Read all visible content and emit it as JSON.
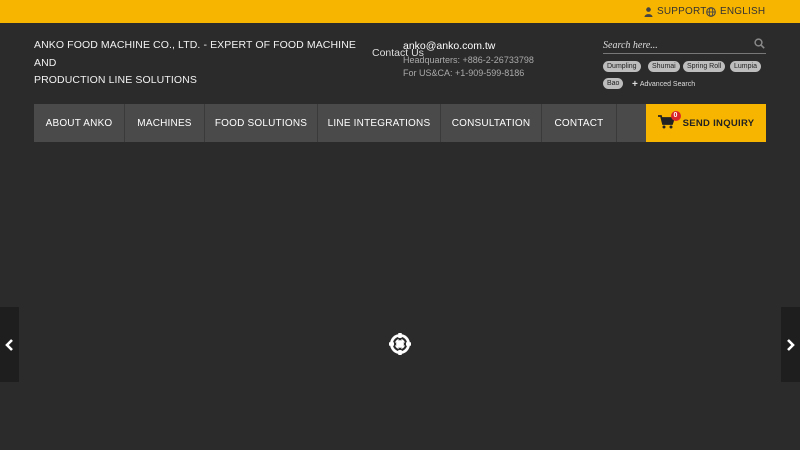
{
  "topbar": {
    "support_label": "SUPPORT",
    "language_label": "ENGLISH",
    "background": "#f8b500"
  },
  "header": {
    "company_line1": "ANKO FOOD MACHINE CO., LTD. - EXPERT OF FOOD MACHINE AND",
    "company_line2": "PRODUCTION LINE SOLUTIONS",
    "contact_link": "Contact Us",
    "email": "anko@anko.com.tw",
    "headquarters": "Headquarters: +886-2-26733798",
    "us_phone": "For US&CA: +1-909-599-8186"
  },
  "search": {
    "placeholder": "Search here...",
    "tags": [
      "Dumpling",
      "Shumai",
      "Spring Roll",
      "Lumpia",
      "Bao"
    ],
    "advanced_label": "Advanced Search"
  },
  "nav": {
    "items": [
      "ABOUT ANKO",
      "MACHINES",
      "FOOD SOLUTIONS",
      "LINE INTEGRATIONS",
      "CONSULTATION",
      "CONTACT"
    ],
    "inquiry_label": "SEND INQUIRY",
    "cart_count": "0"
  },
  "colors": {
    "accent": "#f8b500",
    "background": "#2b2b2b",
    "nav_bg": "#4a4a4a",
    "badge": "#d9262a"
  },
  "icons": {
    "support": "person-icon",
    "language": "globe-icon",
    "search": "search-icon",
    "cart": "cart-icon",
    "prev": "chevron-left-icon",
    "next": "chevron-right-icon",
    "loader": "loading-spinner-icon"
  }
}
